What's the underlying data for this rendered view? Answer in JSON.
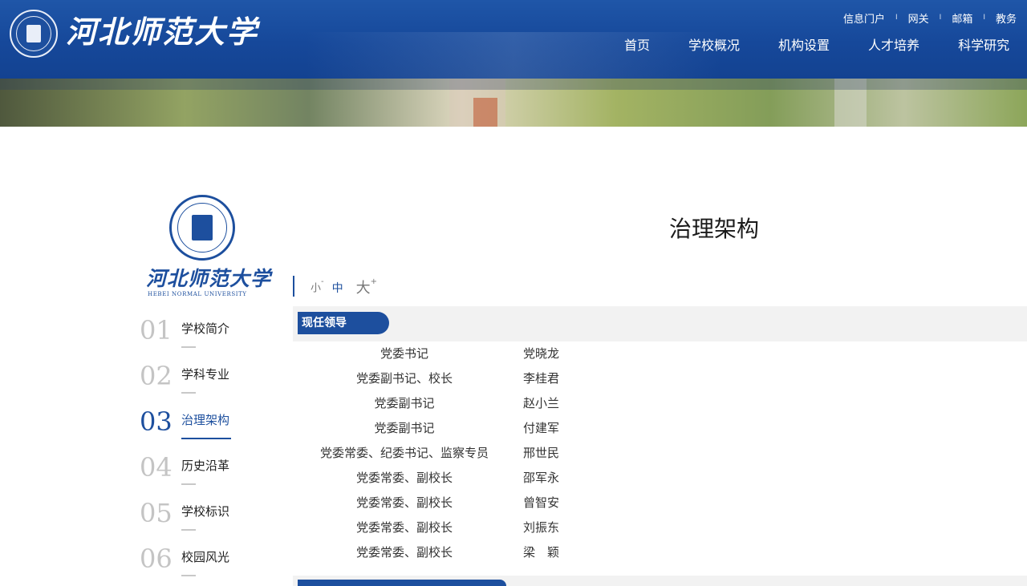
{
  "header": {
    "logo_text": "河北师范大学",
    "top_links": [
      "信息门户",
      "网关",
      "邮箱",
      "教务"
    ],
    "separator": "I",
    "nav": [
      "首页",
      "学校概况",
      "机构设置",
      "人才培养",
      "科学研究"
    ]
  },
  "sidebar": {
    "logo_text": "河北师范大学",
    "logo_sub": "HEBEI NORMAL UNIVERSITY",
    "items": [
      {
        "num": "01",
        "label": "学校简介"
      },
      {
        "num": "02",
        "label": "学科专业"
      },
      {
        "num": "03",
        "label": "治理架构"
      },
      {
        "num": "04",
        "label": "历史沿革"
      },
      {
        "num": "05",
        "label": "学校标识"
      },
      {
        "num": "06",
        "label": "校园风光"
      }
    ],
    "active_index": 2
  },
  "content": {
    "title": "治理架构",
    "font_sizes": {
      "small": "小",
      "small_sup": "-",
      "medium": "中",
      "large": "大",
      "large_sup": "+"
    },
    "section_title": "现任领导",
    "leaders": [
      {
        "position": "党委书记",
        "name": "党晓龙"
      },
      {
        "position": "党委副书记、校长",
        "name": "李桂君"
      },
      {
        "position": "党委副书记",
        "name": "赵小兰"
      },
      {
        "position": "党委副书记",
        "name": "付建军"
      },
      {
        "position": "党委常委、纪委书记、监察专员",
        "name": "邢世民"
      },
      {
        "position": "党委常委、副校长",
        "name": "邵军永"
      },
      {
        "position": "党委常委、副校长",
        "name": "曾智安"
      },
      {
        "position": "党委常委、副校长",
        "name": "刘振东"
      },
      {
        "position": "党委常委、副校长",
        "name": "梁　颖"
      }
    ]
  },
  "colors": {
    "brand": "#1d4f9e",
    "header": "#16489a",
    "band": "#f2f2f2"
  }
}
